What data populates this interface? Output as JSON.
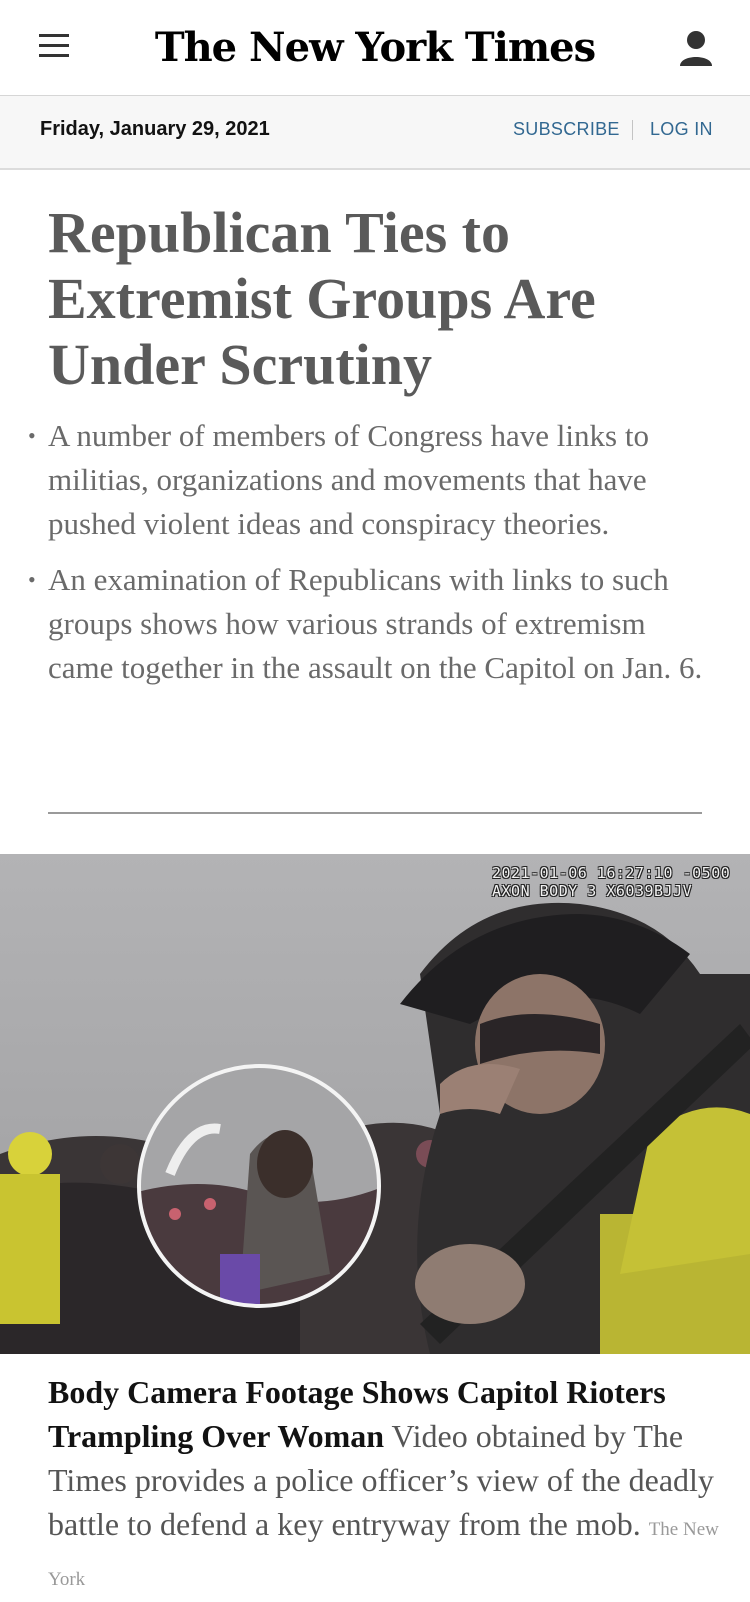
{
  "header": {
    "logo_text": "The New York Times",
    "menu_icon": "hamburger-menu-icon",
    "account_icon": "user-account-icon"
  },
  "datebar": {
    "date": "Friday, January 29, 2021",
    "subscribe_label": "SUBSCRIBE",
    "login_label": "LOG IN",
    "link_color": "#326891"
  },
  "lead_story": {
    "headline": "Republican Ties to Extremist Groups Are Under Scrutiny",
    "summary": [
      "A number of members of Congress have links to militias, organizations and movements that have pushed violent ideas and conspiracy theories.",
      "An examination of Republicans with links to such groups shows how various strands of extremism came together in the assault on the Capitol on Jan. 6."
    ]
  },
  "photo": {
    "stamp_line1": "2021-01-06 16:27:10 -0500",
    "stamp_line2": "AXON BODY 3 X6039BJJV"
  },
  "second_story": {
    "title": "Body Camera Footage Shows Capitol Rioters Trampling Over Woman",
    "summary": "Video obtained by The Times provides a police officer’s view of the deadly battle to defend a key entryway from the mob.",
    "credit": "The New York"
  }
}
